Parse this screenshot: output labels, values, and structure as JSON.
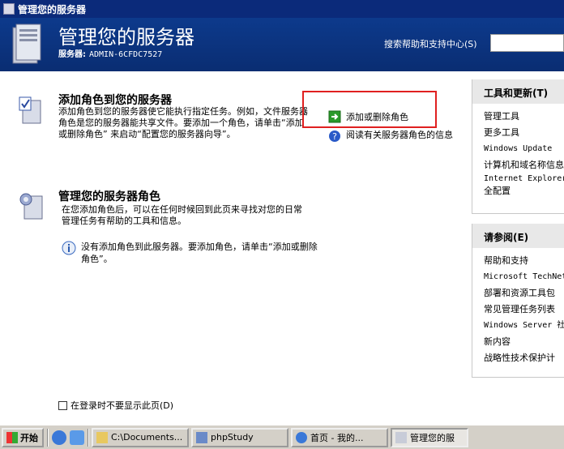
{
  "window": {
    "title": "管理您的服务器"
  },
  "header": {
    "title": "管理您的服务器",
    "server_label": "服务器:",
    "server_name": "ADMIN-6CFDC7527",
    "search_label": "搜索帮助和支持中心(S)",
    "search_value": ""
  },
  "main": {
    "add_role": {
      "title": "添加角色到您的服务器",
      "desc": "添加角色到您的服务器使它能执行指定任务。例如，文件服务器 角色是您的服务器能共享文件。要添加一个角色，请单击“添加或删除角色” 来启动“配置您的服务器向导”。",
      "action_add_remove": "添加或删除角色",
      "action_read_more": "阅读有关服务器角色的信息"
    },
    "manage_role": {
      "title": "管理您的服务器角色",
      "desc": "在您添加角色后，可以在任何时候回到此页来寻找对您的日常管理任务有帮助的工具和信息。",
      "info": "没有添加角色到此服务器。要添加角色，请单击“添加或删除角色”。"
    },
    "dont_show": "在登录时不要显示此页(D)"
  },
  "sidebar": {
    "tools": {
      "head": "工具和更新(T)",
      "items": [
        "管理工具",
        "更多工具",
        "Windows Update",
        "计算机和域名称信息",
        "Internet Explorer",
        "全配置"
      ]
    },
    "see_also": {
      "head": "请参阅(E)",
      "items": [
        "帮助和支持",
        "Microsoft TechNet",
        "部署和资源工具包",
        "常见管理任务列表",
        "Windows Server 社",
        "新内容",
        "战略性技术保护计"
      ]
    }
  },
  "taskbar": {
    "start": "开始",
    "tasks": [
      "C:\\Documents...",
      "phpStudy",
      "首页 - 我的...",
      "管理您的服"
    ]
  },
  "colors": {
    "header_bg": "#0d3a8c",
    "highlight": "#e02020",
    "taskbar": "#d4d0c8"
  }
}
